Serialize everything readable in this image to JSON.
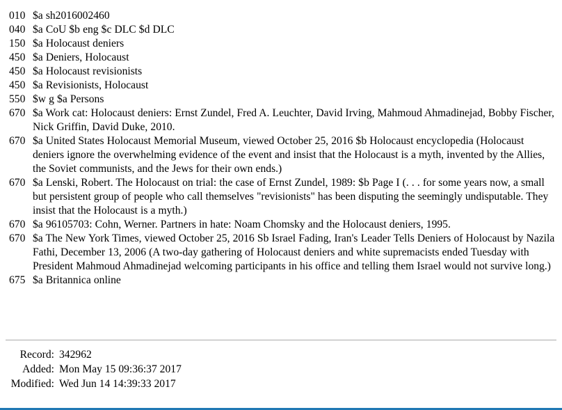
{
  "record": {
    "fields": [
      {
        "tag": "010",
        "value": "$a sh2016002460"
      },
      {
        "tag": "040",
        "value": "$a CoU $b eng $c DLC $d DLC"
      },
      {
        "tag": "150",
        "value": "$a Holocaust deniers"
      },
      {
        "tag": "450",
        "value": "$a Deniers, Holocaust"
      },
      {
        "tag": "450",
        "value": "$a Holocaust revisionists"
      },
      {
        "tag": "450",
        "value": "$a Revisionists, Holocaust"
      },
      {
        "tag": "550",
        "value": "$w g $a Persons"
      },
      {
        "tag": "670",
        "value": "$a Work cat: Holocaust deniers: Ernst Zundel, Fred A. Leuchter, David Irving, Mahmoud Ahmadinejad, Bobby Fischer, Nick Griffin, David Duke, 2010."
      },
      {
        "tag": "670",
        "value": "$a United States Holocaust Memorial Museum, viewed October 25, 2016 $b Holocaust encyclopedia (Holocaust deniers ignore the overwhelming evidence of the event and insist that the Holocaust is a myth, invented by the Allies, the Soviet communists, and the Jews for their own ends.)"
      },
      {
        "tag": "670",
        "value": "$a Lenski, Robert. The Holocaust on trial: the case of Ernst Zundel, 1989: $b Page I (. . . for some years now, a small but persistent group of people who call themselves \"revisionists\" has been disputing the seemingly undisputable. They insist that the Holocaust is a myth.)"
      },
      {
        "tag": "670",
        "value": "$a 96105703: Cohn, Werner. Partners in hate: Noam Chomsky and the Holocaust deniers, 1995."
      },
      {
        "tag": "670",
        "value": "$a The New York Times, viewed October 25, 2016 Sb Israel Fading, Iran's Leader Tells Deniers of Holocaust by Nazila Fathi, December 13, 2006 (A two-day gathering of Holocaust deniers and white supremacists ended Tuesday with President Mahmoud Ahmadinejad welcoming participants in his office and telling them Israel would not survive long.)"
      },
      {
        "tag": "675",
        "value": "$a Britannica online"
      }
    ],
    "meta": [
      {
        "label": "Record:",
        "value": "342962"
      },
      {
        "label": "Added:",
        "value": "Mon May 15 09:36:37 2017"
      },
      {
        "label": "Modified:",
        "value": "Wed Jun 14 14:39:33 2017"
      }
    ]
  },
  "colors": {
    "bottom_border": "#1f78b4",
    "divider": "#a9a9a9",
    "text": "#000000",
    "background": "#ffffff"
  }
}
